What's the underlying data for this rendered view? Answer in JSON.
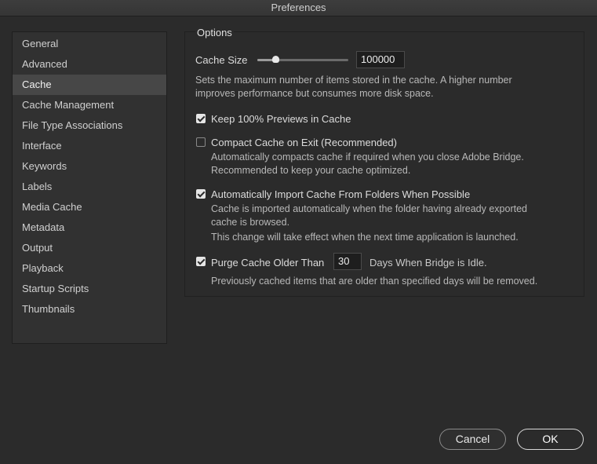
{
  "window": {
    "title": "Preferences"
  },
  "sidebar": {
    "items": [
      {
        "label": "General"
      },
      {
        "label": "Advanced"
      },
      {
        "label": "Cache",
        "selected": true
      },
      {
        "label": "Cache Management"
      },
      {
        "label": "File Type Associations"
      },
      {
        "label": "Interface"
      },
      {
        "label": "Keywords"
      },
      {
        "label": "Labels"
      },
      {
        "label": "Media Cache"
      },
      {
        "label": "Metadata"
      },
      {
        "label": "Output"
      },
      {
        "label": "Playback"
      },
      {
        "label": "Startup Scripts"
      },
      {
        "label": "Thumbnails"
      }
    ]
  },
  "options": {
    "title": "Options",
    "cache_size": {
      "label": "Cache Size",
      "value": "100000",
      "slider_level": 0.2,
      "desc1": "Sets the maximum number of items stored in the cache. A higher number",
      "desc2": "improves performance but consumes more disk space."
    },
    "keep_previews": {
      "label": "Keep 100% Previews in Cache",
      "checked": true
    },
    "compact_cache": {
      "label": "Compact Cache on Exit (Recommended)",
      "checked": false,
      "desc1": "Automatically compacts cache if required when you close Adobe Bridge.",
      "desc2": "Recommended to keep your cache optimized."
    },
    "auto_import": {
      "label": "Automatically Import Cache From Folders When Possible",
      "checked": true,
      "desc1": "Cache is imported automatically when the folder having already exported",
      "desc2": "cache is browsed.",
      "desc3": "This change will take effect when the next time application is launched."
    },
    "purge": {
      "label": "Purge Cache Older Than",
      "checked": true,
      "days_value": "30",
      "suffix": "Days When Bridge is Idle.",
      "desc1": "Previously cached items that are older than specified days will be removed."
    }
  },
  "buttons": {
    "cancel": "Cancel",
    "ok": "OK"
  },
  "colors": {
    "background": "#2b2b2b",
    "selection": "#474747",
    "text": "#d8d8d8"
  }
}
